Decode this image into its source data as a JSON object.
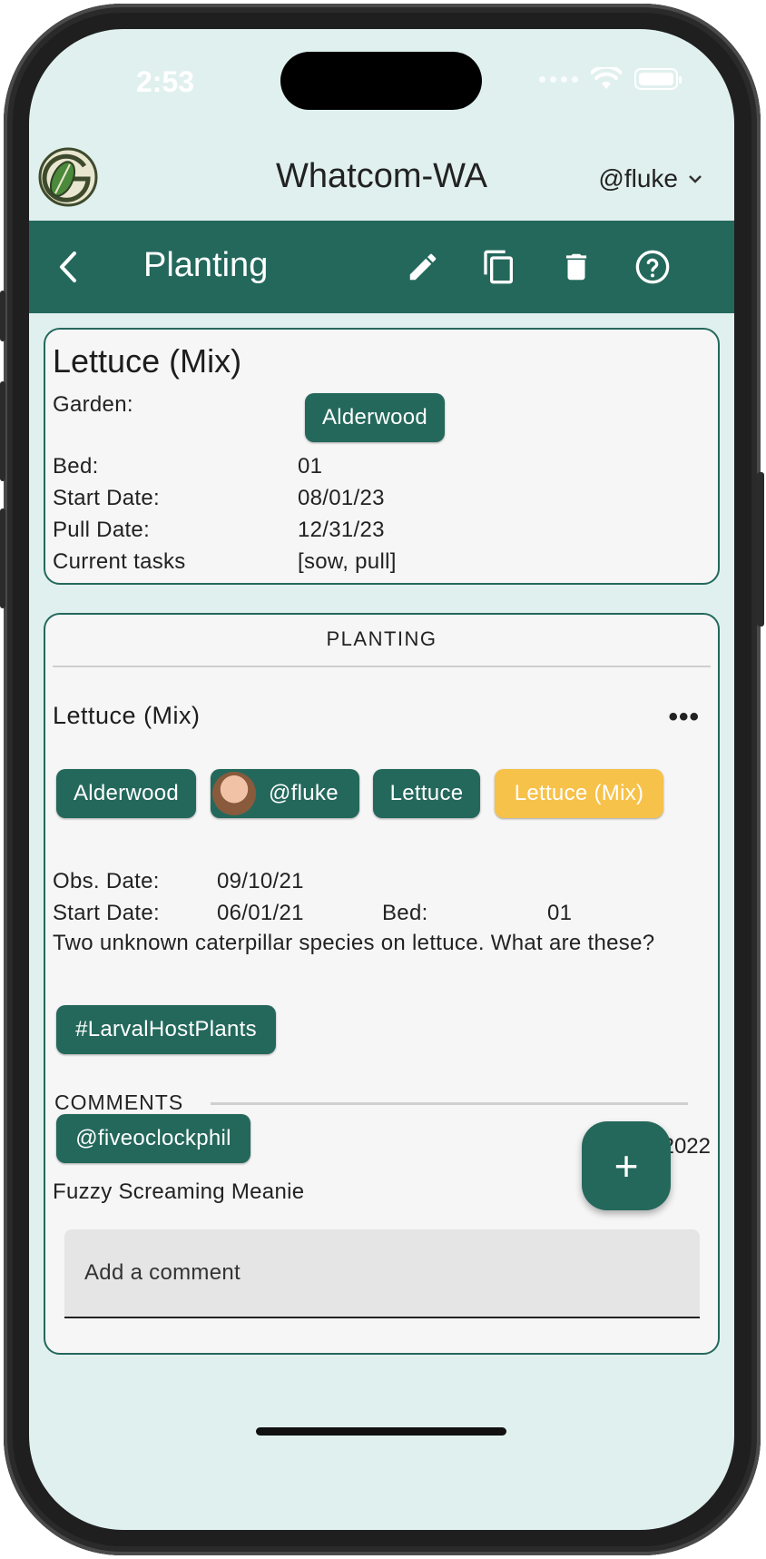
{
  "status_bar": {
    "time": "2:53"
  },
  "header": {
    "region": "Whatcom-WA",
    "user": "@fluke"
  },
  "toolbar": {
    "title": "Planting"
  },
  "planting_card": {
    "title": "Lettuce (Mix)",
    "garden_label": "Garden:",
    "garden_chip": "Alderwood",
    "bed_label": "Bed:",
    "bed_value": "01",
    "start_label": "Start Date:",
    "start_value": "08/01/23",
    "pull_label": "Pull Date:",
    "pull_value": "12/31/23",
    "tasks_label": "Current tasks",
    "tasks_value": "[sow, pull]"
  },
  "observation_card": {
    "section": "PLANTING",
    "title": "Lettuce (Mix)",
    "more": "•••",
    "chips": {
      "garden": "Alderwood",
      "user": "@fluke",
      "crop": "Lettuce",
      "variety": "Lettuce (Mix)"
    },
    "obs_label": "Obs. Date:",
    "obs_value": "09/10/21",
    "start_label": "Start Date:",
    "start_value": "06/01/21",
    "bed_label": "Bed:",
    "bed_value": "01",
    "description": "Two unknown caterpillar species on lettuce. What are these?",
    "tag": "#LarvalHostPlants",
    "comments_label": "COMMENTS",
    "comment": {
      "author": "@fiveoclockphil",
      "date": "6/20/2022",
      "text": "Fuzzy Screaming Meanie"
    },
    "comment_placeholder": "Add a comment"
  },
  "fab": {
    "label": "+"
  },
  "colors": {
    "primary": "#24685c",
    "background": "#e0f0ee",
    "accent": "#f7c24a",
    "card": "#f6f6f6"
  }
}
